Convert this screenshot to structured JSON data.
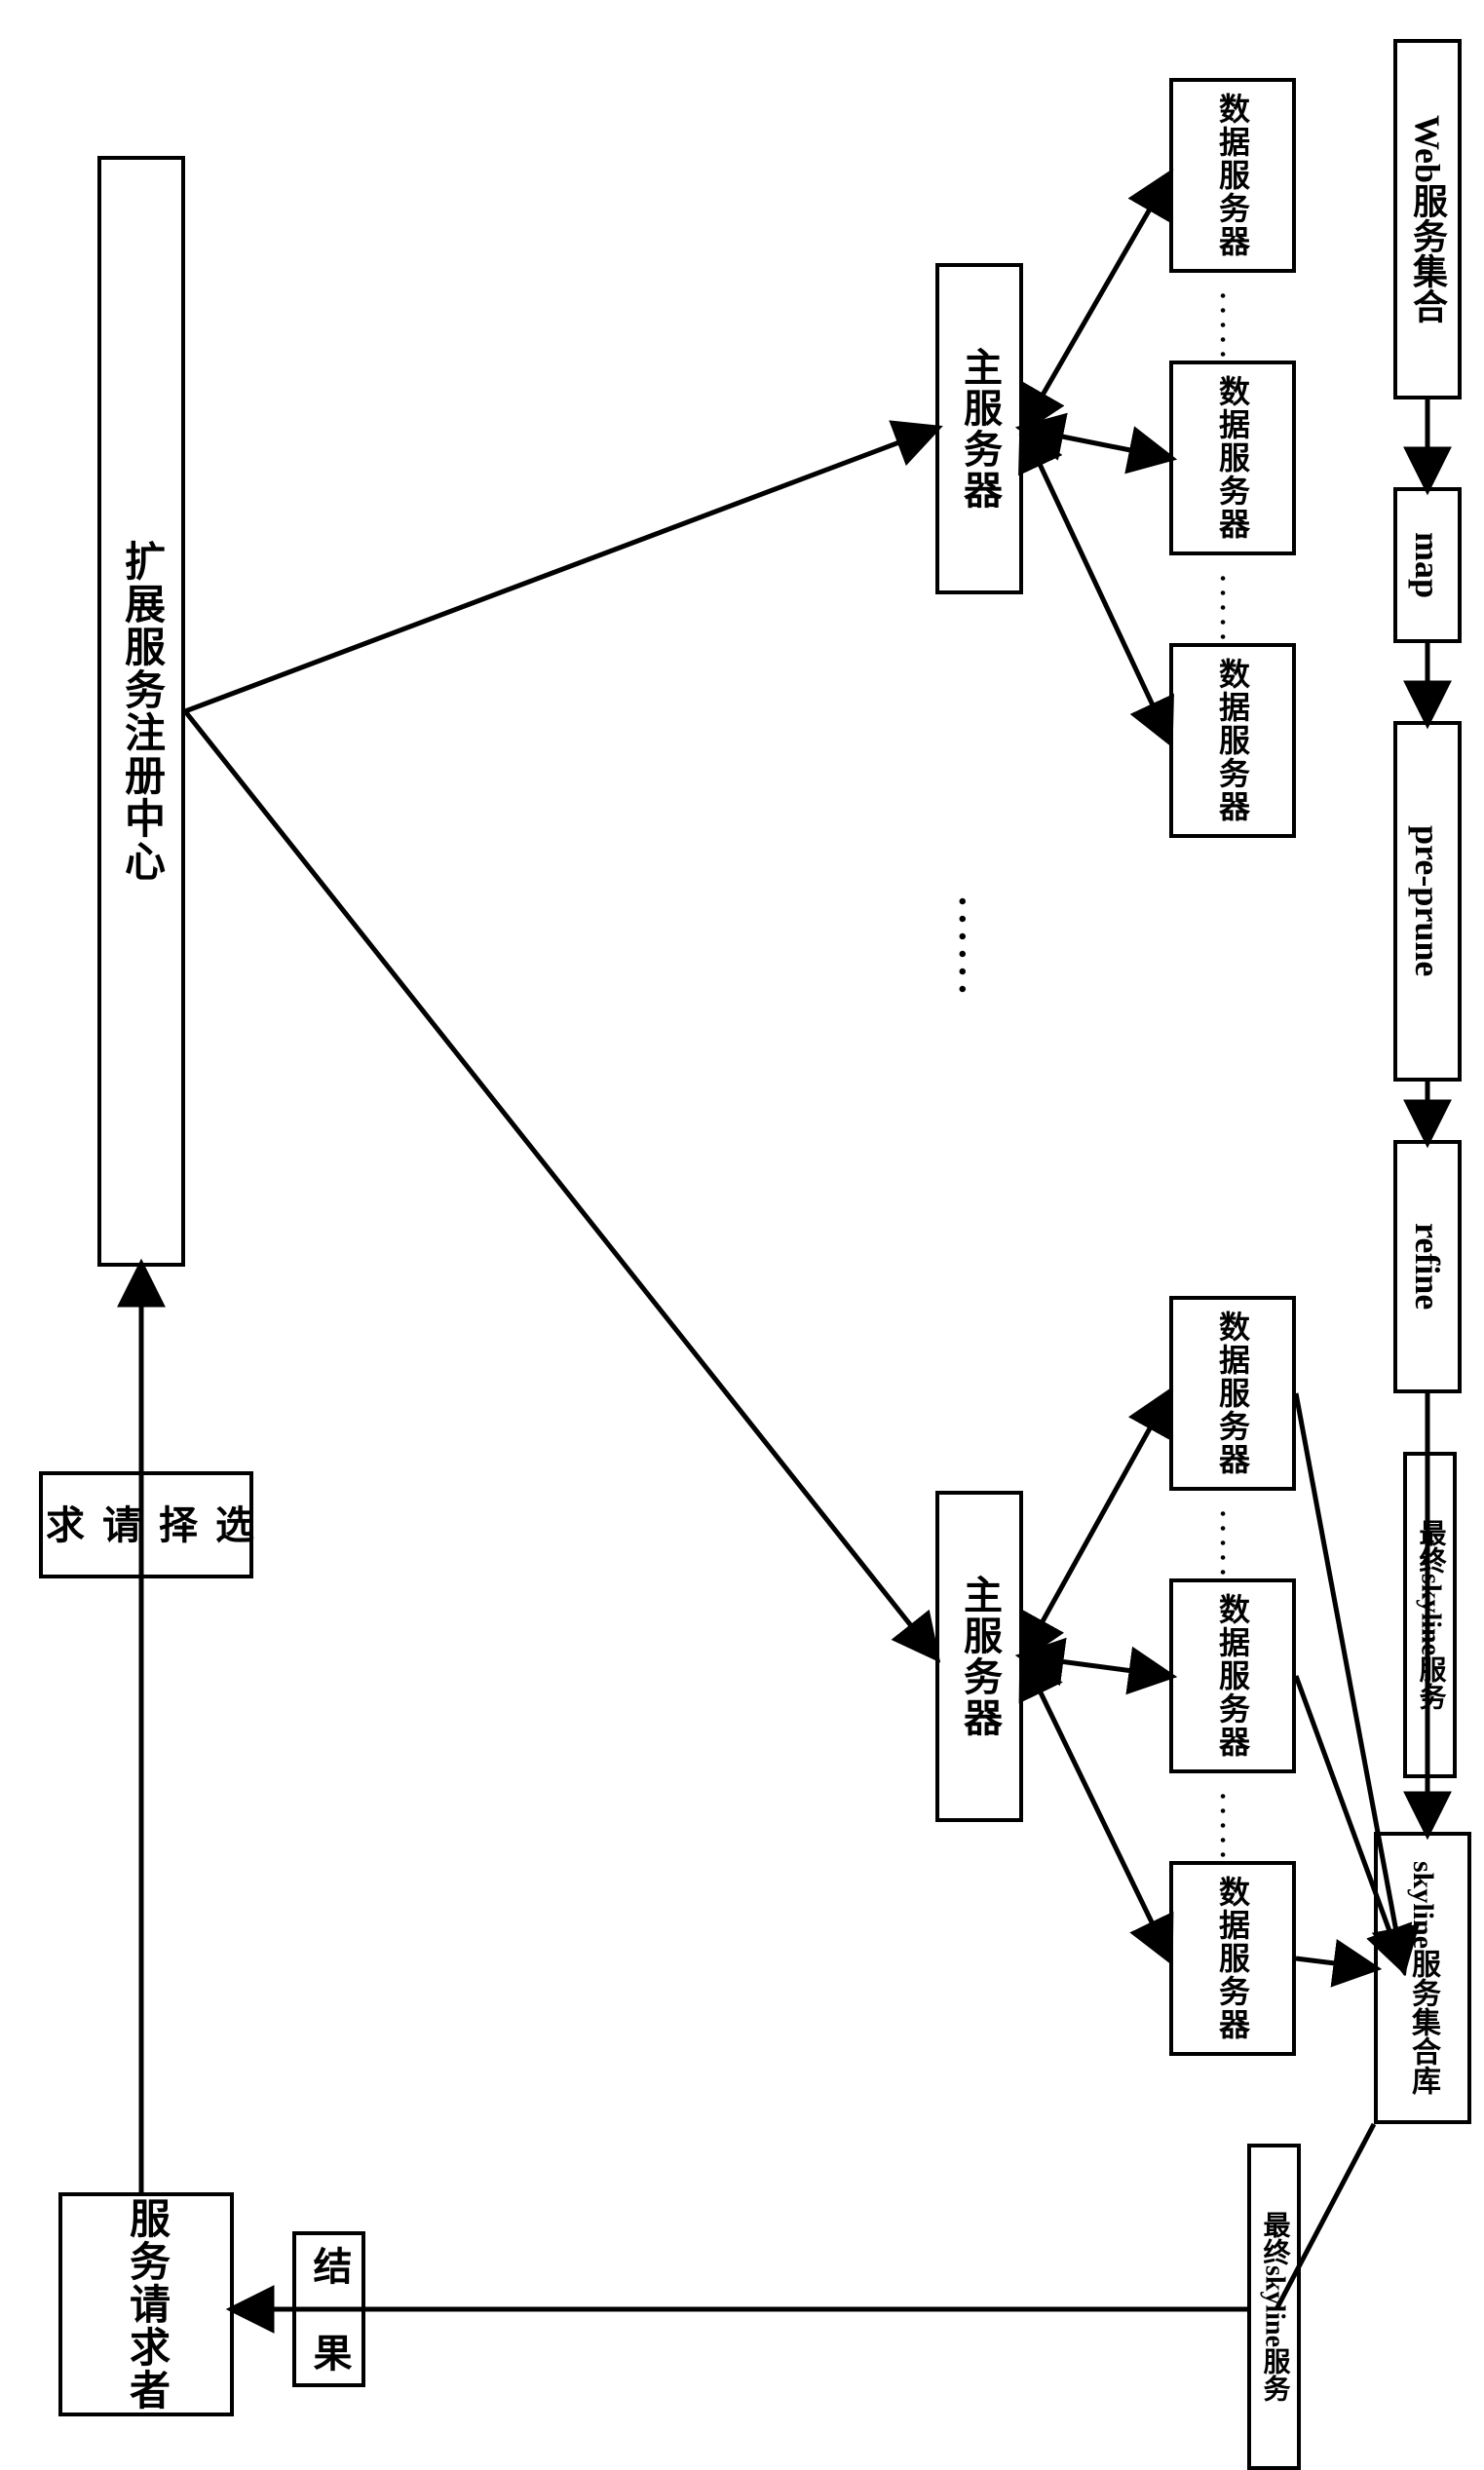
{
  "nodes": {
    "registry": "扩展服务注册中心",
    "requester": "服务请求者",
    "mainServer": "主服务器",
    "dataServer": "数据服务器",
    "webServiceSet": "Web服务集合",
    "map": "map",
    "prePrune": "pre-prune",
    "refine": "refine",
    "skylineLib": "skyline服务集合库"
  },
  "edgeLabels": {
    "selectReq": "选 择 请 求",
    "result": "结 果",
    "finalSkyline1": "最终skyline服务",
    "finalSkyline2": "最终skyline服务"
  },
  "dots": "......"
}
